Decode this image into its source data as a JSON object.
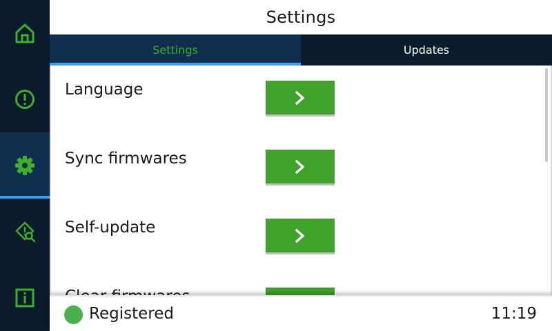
{
  "header": {
    "title": "Settings"
  },
  "sidebar": {
    "items": [
      {
        "icon": "home-icon",
        "active": false
      },
      {
        "icon": "alert-circle-icon",
        "active": false
      },
      {
        "icon": "gear-icon",
        "active": true
      },
      {
        "icon": "diagnostics-icon",
        "active": false
      },
      {
        "icon": "info-icon",
        "active": false
      }
    ]
  },
  "tabs": [
    {
      "label": "Settings",
      "active": true
    },
    {
      "label": "Updates",
      "active": false
    }
  ],
  "settings_list": {
    "items": [
      {
        "label": "Language",
        "button_icon": "chevron-right-icon"
      },
      {
        "label": "Sync firmwares",
        "button_icon": "chevron-right-icon"
      },
      {
        "label": "Self-update",
        "button_icon": "chevron-right-icon"
      },
      {
        "label": "Clear firmwares",
        "button_icon": "chevron-right-icon"
      }
    ]
  },
  "status_bar": {
    "status_text": "Registered",
    "status_color": "#4caf50",
    "time": "11:19"
  },
  "colors": {
    "accent_green": "#3fa22a",
    "active_blue": "#3aa0f2",
    "sidebar_bg": "#0b1b2c"
  }
}
